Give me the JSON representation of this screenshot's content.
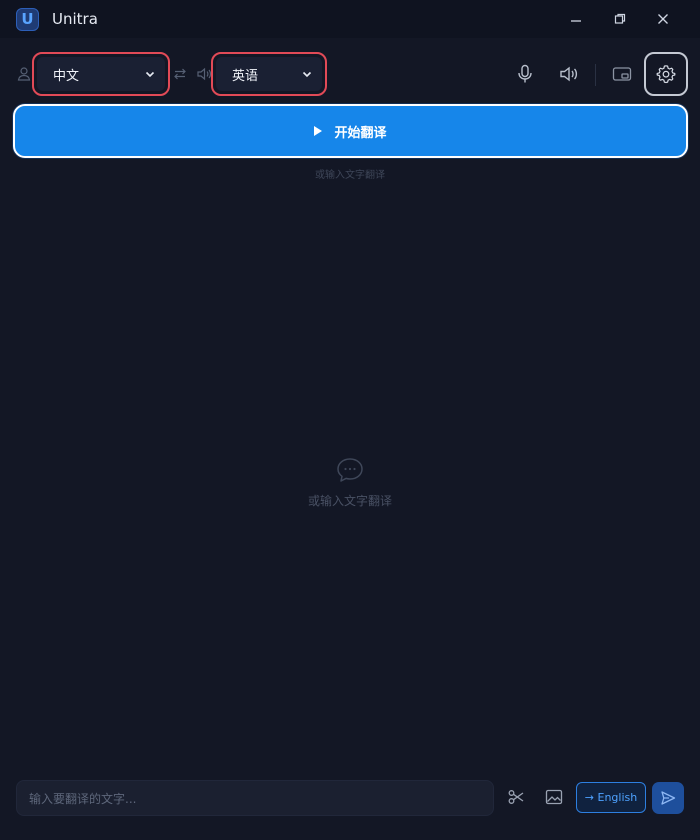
{
  "app": {
    "title": "Unitra",
    "logo_letter": "U"
  },
  "window_controls": {
    "minimize_icon": "minimize-icon",
    "restore_icon": "restore-icon",
    "close_icon": "close-icon"
  },
  "toolbar": {
    "source_language": "中文",
    "target_language": "英语",
    "icons": {
      "speaker_source": "person-icon",
      "swap": "swap-icon",
      "speaker_target": "speaker-icon",
      "mic": "microphone-icon",
      "volume": "volume-icon",
      "pip": "picture-in-picture-icon",
      "settings": "gear-icon"
    }
  },
  "main": {
    "start_label": "开始翻译",
    "small_hint": "或输入文字翻译",
    "empty_text": "或输入文字翻译"
  },
  "bottom": {
    "input_placeholder": "输入要翻译的文字...",
    "lang_button": "→ English"
  },
  "colors": {
    "background": "#131725",
    "titlebar": "#0f1320",
    "accent": "#1686ea",
    "highlight_border": "#e24a57"
  }
}
